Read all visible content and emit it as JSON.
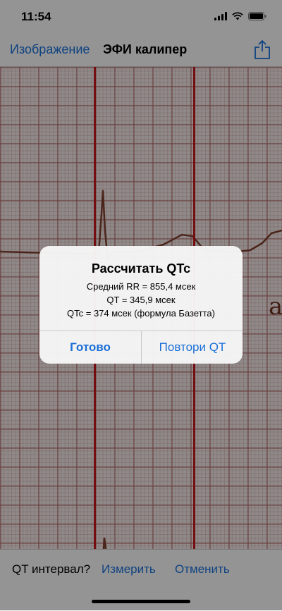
{
  "status_bar": {
    "time": "11:54",
    "icons": [
      "cellular-signal-icon",
      "wifi-icon",
      "battery-icon"
    ]
  },
  "nav": {
    "back_label": "Изображение",
    "title": "ЭФИ калипер",
    "share_icon": "share-icon"
  },
  "ecg": {
    "artifact_text": "a"
  },
  "alert": {
    "title": "Рассчитать QTc",
    "lines": [
      "Средний RR = 855,4 мсек",
      "QT = 345,9 мсек",
      "QTc = 374 мсек (формула Базетта)"
    ],
    "buttons": {
      "done": "Готово",
      "repeat": "Повтори QT"
    }
  },
  "toolbar": {
    "label": "QT интервал?",
    "measure": "Измерить",
    "cancel": "Отменить"
  },
  "colors": {
    "accent": "#1a6fd6",
    "caliper": "#c4161c",
    "ecg_grid": "#af6969"
  }
}
